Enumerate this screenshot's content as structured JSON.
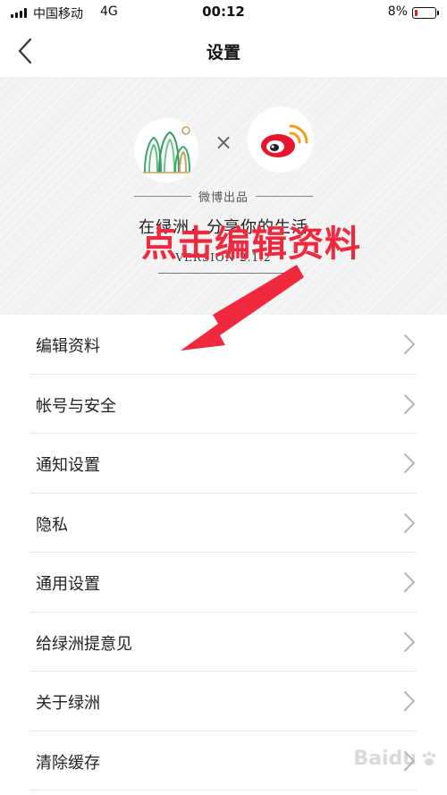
{
  "status_bar": {
    "carrier": "中国移动",
    "network": "4G",
    "time": "00:12",
    "battery_percent": "8%",
    "battery_level": 0.08
  },
  "nav": {
    "title": "设置",
    "back_icon": "chevron-left-icon"
  },
  "banner": {
    "brand": "微博出品",
    "slogan": "在绿洲，分享你的生活",
    "version": "VERSION  2.1.2",
    "times_symbol": "×"
  },
  "menu": {
    "items": [
      {
        "label": "编辑资料"
      },
      {
        "label": "帐号与安全"
      },
      {
        "label": "通知设置"
      },
      {
        "label": "隐私"
      },
      {
        "label": "通用设置"
      },
      {
        "label": "给绿洲提意见"
      },
      {
        "label": "关于绿洲"
      },
      {
        "label": "清除缓存"
      }
    ],
    "chevron_icon": "chevron-right-icon"
  },
  "annotation": {
    "text": "点击编辑资料",
    "color": "#f0293f"
  },
  "watermark": {
    "text": "Baidu"
  },
  "colors": {
    "accent_red": "#f0293f",
    "weibo_red": "#e6162d",
    "oasis_green": "#3aa86b"
  }
}
